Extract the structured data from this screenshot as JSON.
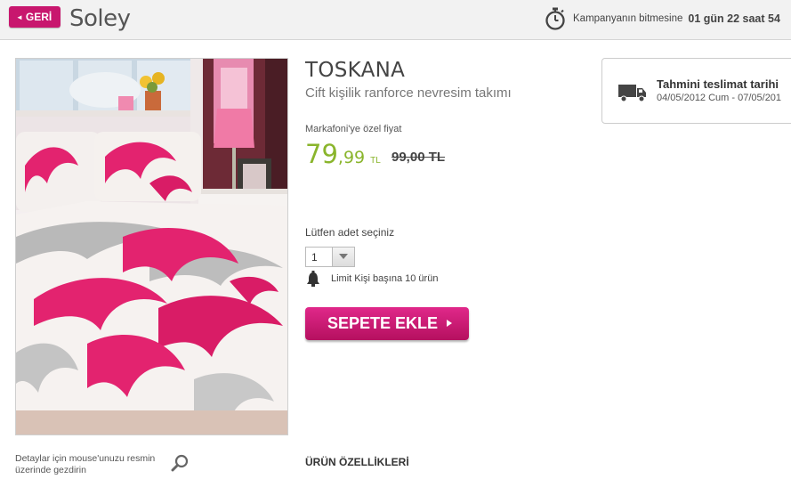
{
  "header": {
    "back_label": "GERİ",
    "brand": "Soley",
    "campaign_label": "Kampanyanın bitmesine",
    "campaign_remaining": "01 gün 22 saat 54"
  },
  "product": {
    "image_name": "bedding-photo",
    "title": "TOSKANA",
    "subtitle": "Cift kişilik ranforce nevresim takımı",
    "price_label": "Markafoni'ye özel fiyat",
    "price_int": "79",
    "price_dec": ",99",
    "currency": "TL",
    "old_price": "99,00 TL",
    "qty_label": "Lütfen adet seçiniz",
    "qty_value": "1",
    "limit_text": "Limit Kişi başına 10 ürün",
    "cart_button": "SEPETE EKLE",
    "zoom_hint": "Detaylar için mouse'unuzu resmin üzerinde gezdirin",
    "features_heading": "ÜRÜN ÖZELLİKLERİ"
  },
  "delivery": {
    "title": "Tahmini teslimat tarihi",
    "dates": "04/05/2012 Cum - 07/05/201"
  },
  "colors": {
    "brand_pink": "#c8176e",
    "price_green": "#8ab52c"
  },
  "icons": {
    "timer": "stopwatch-icon",
    "truck": "truck-icon",
    "bell": "bell-icon",
    "zoom": "search-icon"
  }
}
